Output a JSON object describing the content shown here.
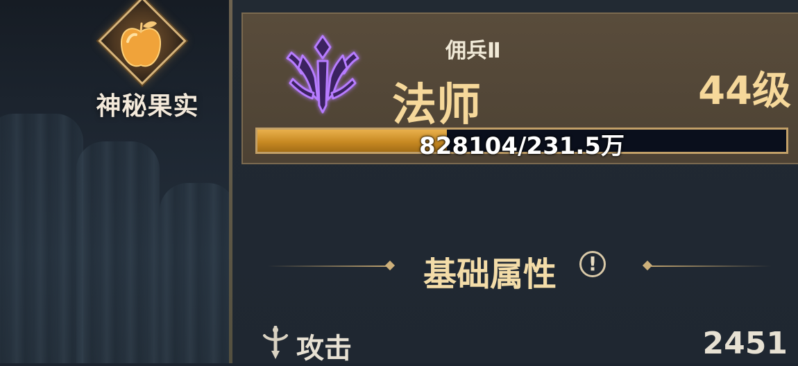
{
  "item": {
    "name": "神秘果实",
    "icon": "apple-icon"
  },
  "character": {
    "emblem_icon": "purple-crown-emblem-icon",
    "subclass": "佣兵Ⅱ",
    "class_name": "法师",
    "level": "44级",
    "xp_text": "828104/231.5万",
    "xp_fraction": 0.3577
  },
  "attributes": {
    "section_title": "基础属性",
    "info_icon": "exclamation-circle-icon",
    "stats": [
      {
        "icon": "sword-icon",
        "label": "攻击",
        "value": "2451"
      }
    ]
  },
  "colors": {
    "gold_text": "#f6d89a",
    "xp_fill": "#d9a13a",
    "emblem_purple": "#a35cff"
  }
}
